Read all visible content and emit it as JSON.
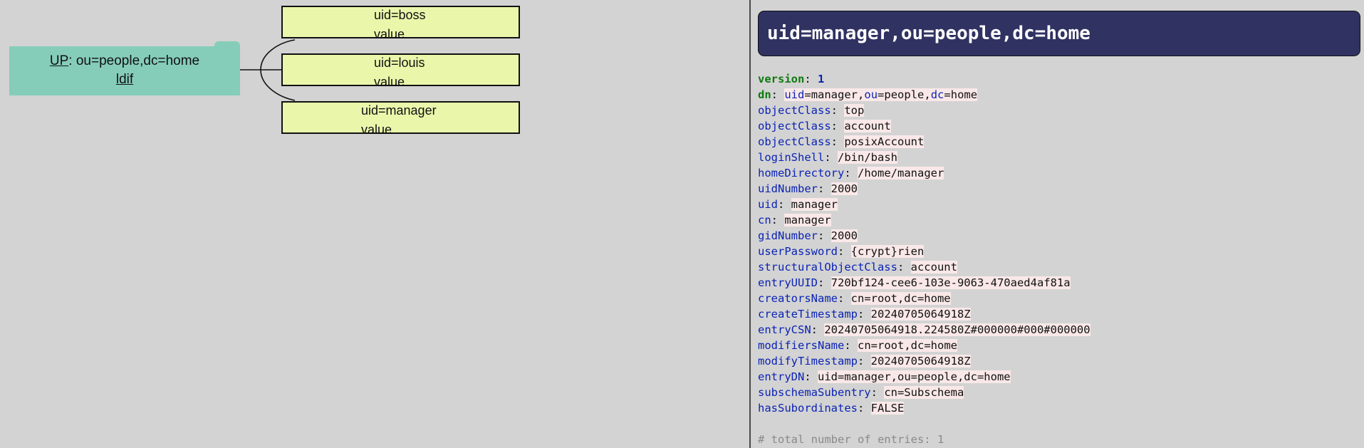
{
  "tree": {
    "parent": {
      "up_label": "UP",
      "dn": ": ou=people,dc=home",
      "link": "ldif"
    },
    "children": [
      {
        "uid": "uid=boss",
        "value": "value"
      },
      {
        "uid": "uid=louis",
        "value": "value"
      },
      {
        "uid": "uid=manager",
        "value": "value"
      }
    ]
  },
  "entry": {
    "title": "uid=manager,ou=people,dc=home",
    "version_key": "version",
    "version_value": "1",
    "dn_key": "dn",
    "dn_parts": [
      "uid",
      "manager",
      "ou",
      "people",
      "dc",
      "home"
    ],
    "attributes": [
      {
        "key": "objectClass",
        "value": "top"
      },
      {
        "key": "objectClass",
        "value": "account"
      },
      {
        "key": "objectClass",
        "value": "posixAccount"
      },
      {
        "key": "loginShell",
        "value": "/bin/bash"
      },
      {
        "key": "homeDirectory",
        "value": "/home/manager"
      },
      {
        "key": "uidNumber",
        "value": "2000"
      },
      {
        "key": "uid",
        "value": "manager"
      },
      {
        "key": "cn",
        "value": "manager"
      },
      {
        "key": "gidNumber",
        "value": "2000"
      },
      {
        "key": "userPassword",
        "value": "{crypt}rien"
      },
      {
        "key": "structuralObjectClass",
        "value": "account"
      },
      {
        "key": "entryUUID",
        "value": "720bf124-cee6-103e-9063-470aed4af81a"
      },
      {
        "key": "creatorsName",
        "value": "cn=root,dc=home"
      },
      {
        "key": "createTimestamp",
        "value": "20240705064918Z"
      },
      {
        "key": "entryCSN",
        "value": "20240705064918.224580Z#000000#000#000000"
      },
      {
        "key": "modifiersName",
        "value": "cn=root,dc=home"
      },
      {
        "key": "modifyTimestamp",
        "value": "20240705064918Z"
      },
      {
        "key": "entryDN",
        "value": "uid=manager,ou=people,dc=home"
      },
      {
        "key": "subschemaSubentry",
        "value": "cn=Subschema"
      },
      {
        "key": "hasSubordinates",
        "value": "FALSE"
      }
    ],
    "footer_comment": "# total number of entries: 1"
  },
  "colors": {
    "folder": "#85cdb9",
    "child_node": "#eaf7ab",
    "title_bar": "#303262",
    "attribute_key": "#0b23b4",
    "version_key": "#0f7a0f",
    "value_highlight": "#fae8e8"
  }
}
